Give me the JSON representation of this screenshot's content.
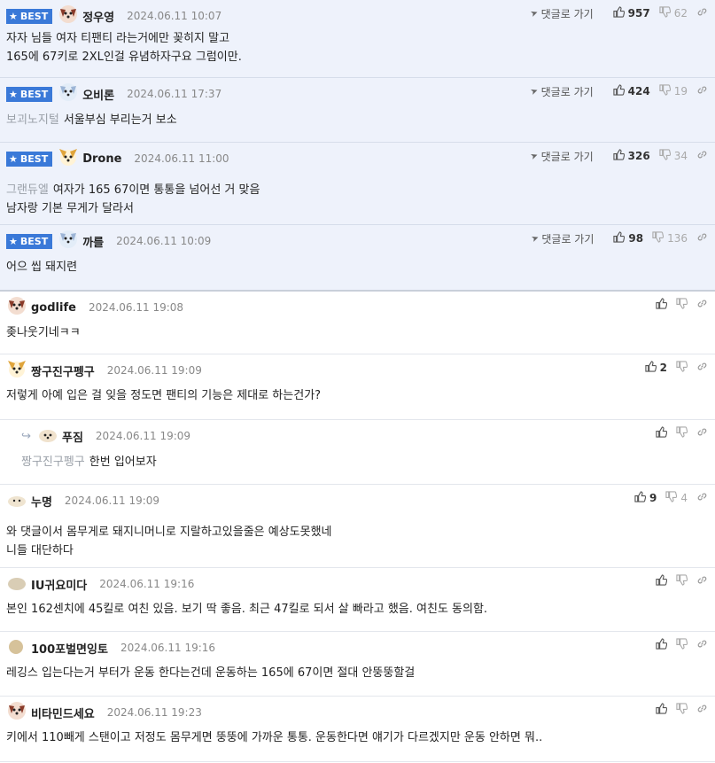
{
  "goto_reply_label": "댓글로 가기",
  "best_label": "BEST",
  "colors": {
    "best_bg": "#eef2fb",
    "badge": "#3a79d8"
  },
  "comments": [
    {
      "best": true,
      "avatar": "dog-red",
      "nick": "정우영",
      "date": "2024.06.11 10:07",
      "up": "957",
      "down": "62",
      "ref": "",
      "lines": [
        "자자 님들 여자 티팬티 라는거에만 꽂히지 말고",
        "165에 67키로 2XL인걸 유념하자구요 그럼이만."
      ]
    },
    {
      "best": true,
      "avatar": "dog-blue",
      "nick": "오비론",
      "date": "2024.06.11 17:37",
      "up": "424",
      "down": "19",
      "ref": "보괴노지털",
      "lines": [
        "서울부심 부리는거 보소"
      ]
    },
    {
      "best": true,
      "avatar": "dog-yellow",
      "nick": "Drone",
      "date": "2024.06.11 11:00",
      "up": "326",
      "down": "34",
      "ref": "그랜듀엘",
      "lines": [
        "여자가 165 67이면 통통을 넘어선 거 맞음",
        "남자랑 기본 무게가 달라서"
      ]
    },
    {
      "best": true,
      "avatar": "dog-blue",
      "nick": "까를",
      "date": "2024.06.11 10:09",
      "up": "98",
      "down": "136",
      "ref": "",
      "lines": [
        "어으 씹 돼지련"
      ]
    },
    {
      "best": false,
      "avatar": "dog-red",
      "nick": "godlife",
      "date": "2024.06.11 19:08",
      "up": "",
      "down": "",
      "ref": "",
      "lines": [
        "좆나웃기네ㅋㅋ"
      ]
    },
    {
      "best": false,
      "avatar": "dog-yellow",
      "nick": "짱구진구펭구",
      "date": "2024.06.11 19:09",
      "up": "2",
      "down": "",
      "ref": "",
      "lines": [
        "저렇게 아예 입은 걸 잊을 정도면 팬티의 기능은 제대로 하는건가?"
      ]
    },
    {
      "best": false,
      "reply": true,
      "avatar": "chick",
      "nick": "푸짐",
      "date": "2024.06.11 19:09",
      "up": "",
      "down": "",
      "ref": "짱구진구펭구",
      "lines": [
        "한번 입어보자"
      ]
    },
    {
      "best": false,
      "avatar": "puppy",
      "nick": "누명",
      "date": "2024.06.11 19:09",
      "up": "9",
      "down": "4",
      "ref": "",
      "lines": [
        "와 댓글이서 몸무게로 돼지니머니로 지랄하고있을줄은 예상도못했네",
        "니들 대단하다"
      ]
    },
    {
      "best": false,
      "avatar": "blob",
      "nick": "IU귀요미다",
      "date": "2024.06.11 19:16",
      "up": "",
      "down": "",
      "ref": "",
      "lines": [
        "본인 162센치에 45킬로 여친 있음. 보기 딱 좋음. 최근 47킬로 되서 살 빠라고 했음. 여친도 동의함."
      ]
    },
    {
      "best": false,
      "avatar": "egg",
      "nick": "100포벌면잉토",
      "date": "2024.06.11 19:16",
      "up": "",
      "down": "",
      "ref": "",
      "lines": [
        "레깅스 입는다는거 부터가 운동 한다는건데 운동하는 165에 67이면 절대 안뚱뚱할걸"
      ]
    },
    {
      "best": false,
      "avatar": "dog-red",
      "nick": "비타민드세요",
      "date": "2024.06.11 19:23",
      "up": "",
      "down": "",
      "ref": "",
      "lines": [
        "키에서 110빼게 스탠이고 저정도 몸무게면 뚱뚱에 가까운 통통. 운동한다면 얘기가 다르겠지만 운동 안하면 뭐.."
      ]
    }
  ]
}
